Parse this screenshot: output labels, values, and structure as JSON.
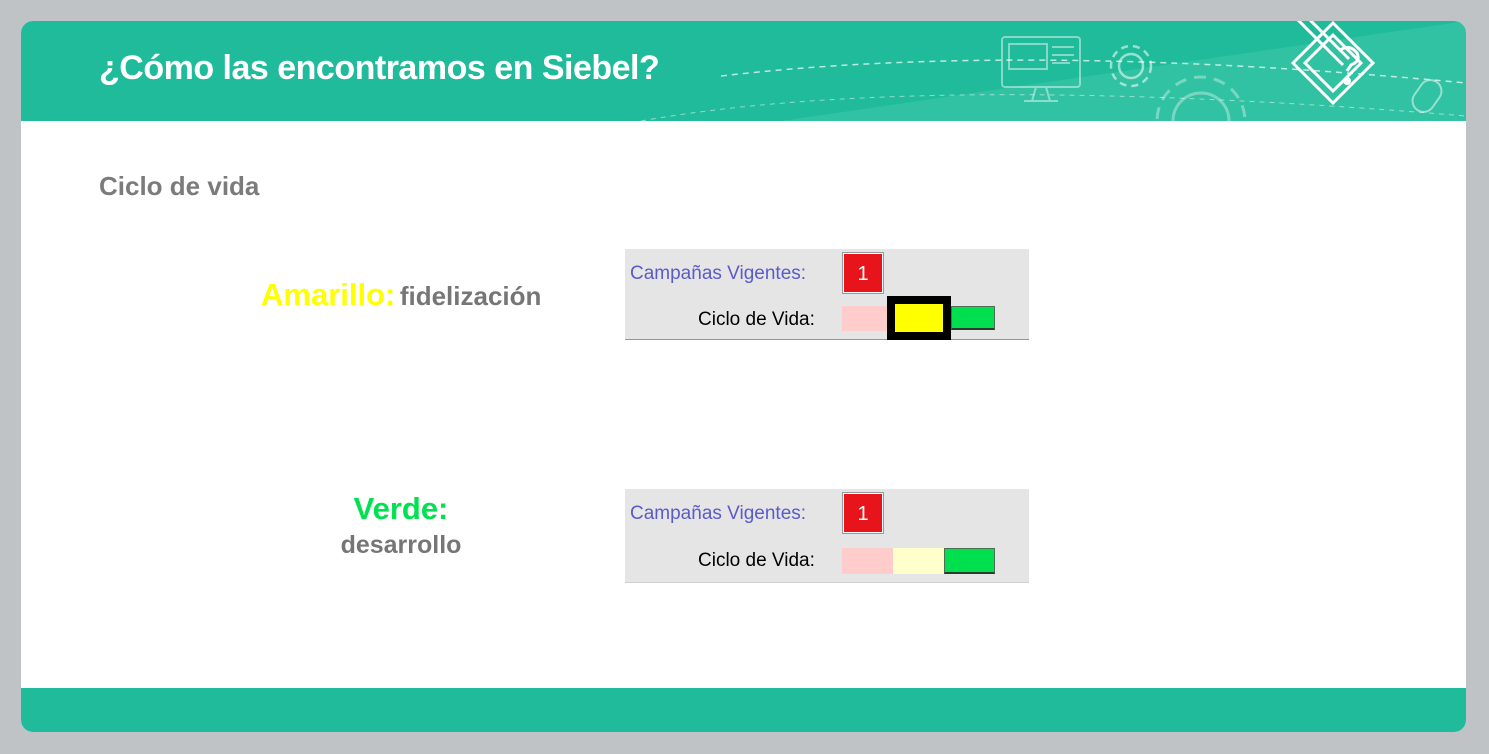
{
  "header": {
    "title": "¿Cómo las encontramos en Siebel?"
  },
  "content": {
    "subtitle": "Ciclo de vida"
  },
  "items": [
    {
      "key": "Amarillo:",
      "desc": "fidelización",
      "key_color": "#ffff00"
    },
    {
      "key": "Verde:",
      "desc": "desarrollo",
      "key_color": "#00e24f"
    }
  ],
  "panels": [
    {
      "campaigns_label": "Campañas Vigentes:",
      "campaigns_count": "1",
      "lifecycle_label": "Ciclo de Vida:",
      "selected_stage": "yellow",
      "stage_colors": [
        "#ffcccc",
        "#ffff00",
        "#00e04e"
      ]
    },
    {
      "campaigns_label": "Campañas Vigentes:",
      "campaigns_count": "1",
      "lifecycle_label": "Ciclo de Vida:",
      "selected_stage": "green",
      "stage_colors": [
        "#ffcccc",
        "#ffffcc",
        "#00e04e"
      ]
    }
  ],
  "theme": {
    "accent": "#1fbb9a",
    "badge": "#e8141c"
  }
}
